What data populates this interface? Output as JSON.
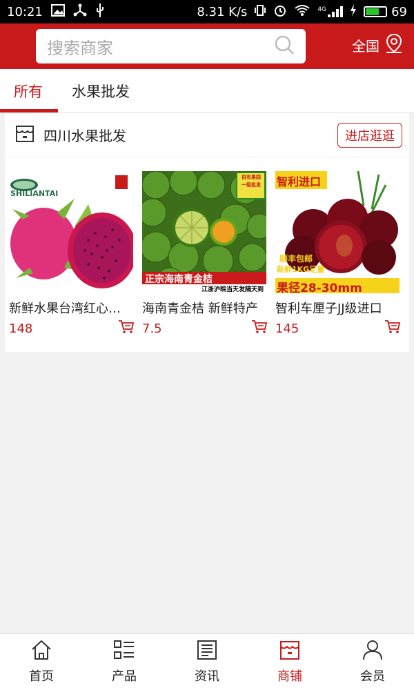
{
  "status_bar": {
    "time": "10:21",
    "speed": "8.31 K/s",
    "network": "4G",
    "battery": "69",
    "battery_level": 0.69
  },
  "header": {
    "search_placeholder": "搜索商家",
    "region": "全国"
  },
  "tabs": [
    {
      "label": "所有",
      "active": true
    },
    {
      "label": "水果批发",
      "active": false
    }
  ],
  "store": {
    "name": "四川水果批发",
    "enter_label": "进店逛逛"
  },
  "products": [
    {
      "title": "新鲜水果台湾红心火龙果",
      "price": "148",
      "image": "dragon-fruit",
      "brand": "SHILIANTAI"
    },
    {
      "title": "海南青金桔 新鲜特产",
      "price": "7.5",
      "image": "green-kumquat",
      "badge": "自有果园 一级批发",
      "banner": "正宗海南青金桔",
      "sub_banner": "江浙沪皖当天发隔天到"
    },
    {
      "title": "智利车厘子JJ级进口",
      "price": "145",
      "image": "cherries",
      "banner_top": "智利进口",
      "promo1": "顺丰包邮",
      "promo2": "新鲜1KG足量",
      "size": "果径28-30mm"
    }
  ],
  "bottom_nav": [
    {
      "label": "首页",
      "icon": "home-icon",
      "active": false
    },
    {
      "label": "产品",
      "icon": "list-grid-icon",
      "active": false
    },
    {
      "label": "资讯",
      "icon": "news-icon",
      "active": false
    },
    {
      "label": "商铺",
      "icon": "shop-icon",
      "active": true
    },
    {
      "label": "会员",
      "icon": "user-icon",
      "active": false
    }
  ],
  "colors": {
    "accent": "#c81a1a",
    "background": "#f2f2f2"
  }
}
